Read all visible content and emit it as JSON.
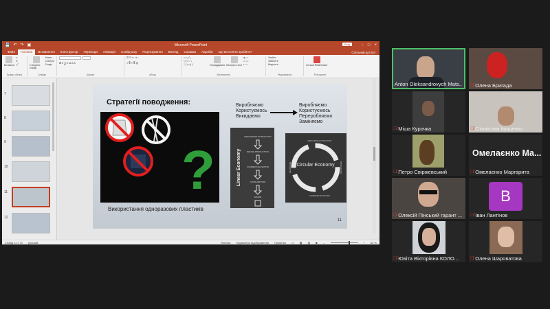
{
  "ppt": {
    "title": "Microsoft PowerPoint",
    "qat": [
      "💾",
      "↶",
      "↷",
      "▣"
    ],
    "signin": "Вхід",
    "tabs": [
      "Файл",
      "Головна",
      "Вставлення",
      "Конструктор",
      "Переходи",
      "Анімація",
      "Слайд-шоу",
      "Рецензування",
      "Вигляд",
      "Справка",
      "Акробат",
      "Що ви хочете зробити?"
    ],
    "share": "Спільний доступ",
    "ribbon": {
      "paste": "Вставити",
      "clipboard": "Буфер обміну",
      "new_slide": "Створити слайд",
      "layout": "Макет",
      "reset": "Скинути",
      "section": "Розділ",
      "slides_group": "Слайди",
      "font_group": "Шрифт",
      "paragraph_group": "Абзац",
      "arrange": "Упорядкувати",
      "quick_styles": "Експрес-стилі",
      "drawing_group": "Малювання",
      "find": "Знайти",
      "replace": "Замінити",
      "select": "Виділити",
      "editing_group": "Редагування",
      "consult": "Consult ReaDresser",
      "addin_group": "Роз'єднати"
    },
    "thumbnails": [
      {
        "num": "7"
      },
      {
        "num": "8"
      },
      {
        "num": "9"
      },
      {
        "num": "10"
      },
      {
        "num": "11"
      },
      {
        "num": "12"
      }
    ],
    "slide": {
      "title": "Стратегії поводження:",
      "caption": "Використання одноразових пластиків",
      "col1": [
        "Виробляємо",
        "Користуємось",
        "Викидаємо"
      ],
      "col2": [
        "Виробляємо",
        "Користуємось",
        "Переробляємо",
        "Заміняємо"
      ],
      "linear_label": "Linear Economy",
      "linear_steps": [
        "RESOURCES EXTRACTION",
        "DEFINE PRODUCTION",
        "COMMERCIALISATION",
        "CONSUMPTION",
        "WASTE"
      ],
      "circular_label": "Circular Economy",
      "circular_steps": [
        "RESOURCE EXTRACTION",
        "PRODUCTION",
        "COMMERCIALISATION",
        "RECYCLING"
      ],
      "page_number": "11",
      "question_mark": "?"
    },
    "status": {
      "left": "Слайд 11 з 74",
      "lang": "русский",
      "notes": "Нотатки",
      "display": "Параметри відображення",
      "comments": "Примітки",
      "zoom": "83 %"
    }
  },
  "participants": [
    {
      "name": "Anton Oleksandrovych Mats..",
      "muted": false,
      "active": true,
      "kind": "video"
    },
    {
      "name": "Олена Бригада",
      "muted": true,
      "active": false,
      "kind": "video"
    },
    {
      "name": "Міша Курочка",
      "muted": true,
      "active": false,
      "kind": "video"
    },
    {
      "name": "Станіслав Іващенко",
      "muted": true,
      "active": false,
      "kind": "video"
    },
    {
      "name": "Петро Свіржевський",
      "muted": true,
      "active": false,
      "kind": "photo"
    },
    {
      "name": "Омелаенко Маргарита",
      "muted": true,
      "active": false,
      "kind": "text",
      "display": "Омелаєнко Ма..."
    },
    {
      "name": "Олексій Пінський гарант ...",
      "muted": true,
      "active": false,
      "kind": "video"
    },
    {
      "name": "Іван Лантінов",
      "muted": true,
      "active": false,
      "kind": "avatar",
      "letter": "B"
    },
    {
      "name": "Ювіта Вікторівна КОЛО...",
      "muted": true,
      "active": false,
      "kind": "photo"
    },
    {
      "name": "Олена Шароватова",
      "muted": true,
      "active": false,
      "kind": "photo"
    }
  ],
  "colors": {
    "ppt_accent": "#b7472a",
    "active_speaker": "#4fbf6a",
    "muted": "#e23b3b",
    "avatar_bg": "#a637c0"
  }
}
